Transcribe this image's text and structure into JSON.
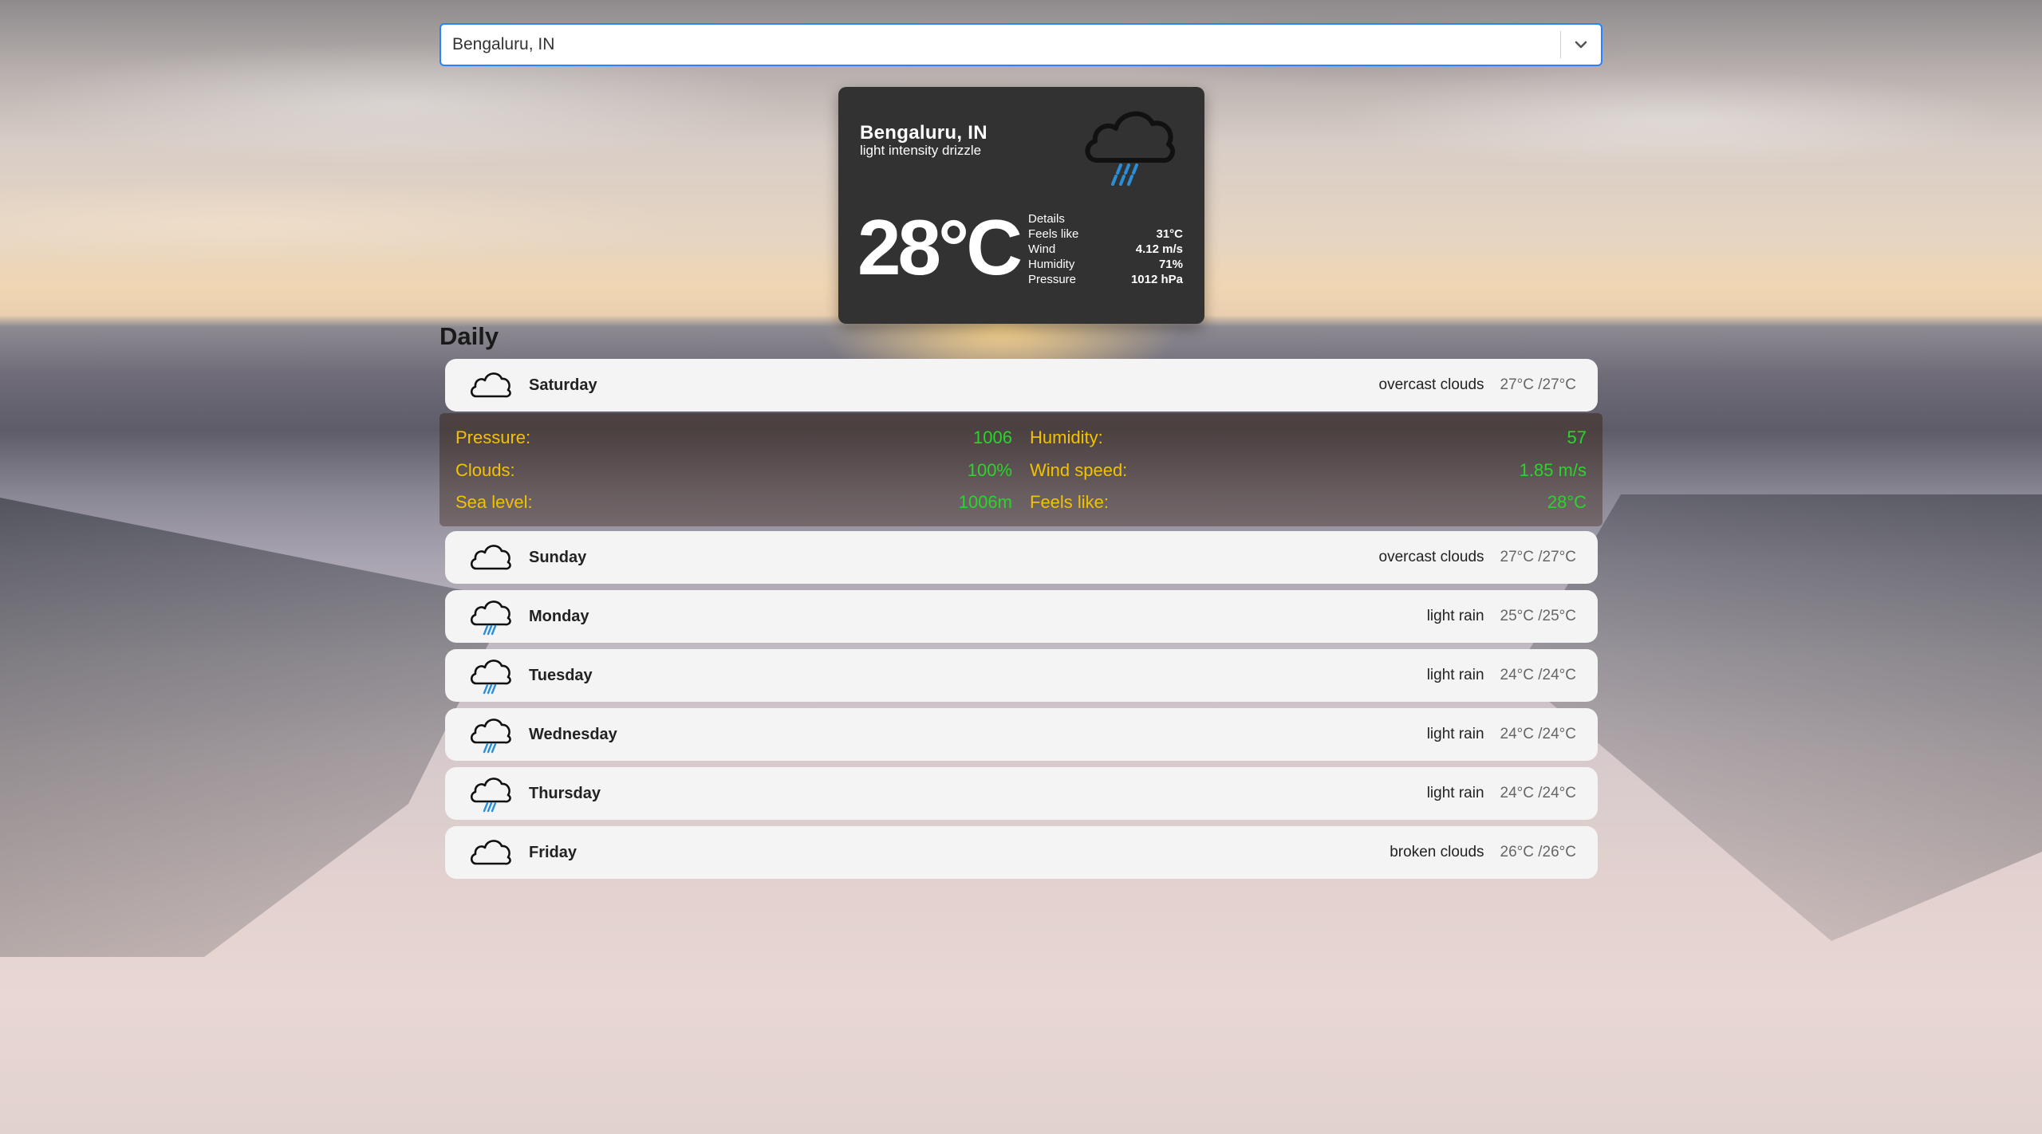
{
  "search": {
    "value": "Bengaluru, IN"
  },
  "current": {
    "city": "Bengaluru, IN",
    "description": "light intensity drizzle",
    "icon": "drizzle-cloud-icon",
    "temperature": "28°C",
    "details_title": "Details",
    "details": [
      {
        "label": "Feels like",
        "value": "31°C"
      },
      {
        "label": "Wind",
        "value": "4.12 m/s"
      },
      {
        "label": "Humidity",
        "value": "71%"
      },
      {
        "label": "Pressure",
        "value": "1012 hPa"
      }
    ]
  },
  "daily": {
    "title": "Daily",
    "days": [
      {
        "name": "Saturday",
        "icon": "cloud-icon",
        "desc": "overcast clouds",
        "temp": "27°C /27°C"
      },
      {
        "name": "Sunday",
        "icon": "cloud-icon",
        "desc": "overcast clouds",
        "temp": "27°C /27°C"
      },
      {
        "name": "Monday",
        "icon": "rain-cloud-icon",
        "desc": "light rain",
        "temp": "25°C /25°C"
      },
      {
        "name": "Tuesday",
        "icon": "rain-cloud-icon",
        "desc": "light rain",
        "temp": "24°C /24°C"
      },
      {
        "name": "Wednesday",
        "icon": "rain-cloud-icon",
        "desc": "light rain",
        "temp": "24°C /24°C"
      },
      {
        "name": "Thursday",
        "icon": "rain-cloud-icon",
        "desc": "light rain",
        "temp": "24°C /24°C"
      },
      {
        "name": "Friday",
        "icon": "cloud-icon",
        "desc": "broken clouds",
        "temp": "26°C /26°C"
      }
    ],
    "expanded": {
      "left": [
        {
          "label": "Pressure:",
          "value": "1006"
        },
        {
          "label": "Clouds:",
          "value": "100%"
        },
        {
          "label": "Sea level:",
          "value": "1006m"
        }
      ],
      "right": [
        {
          "label": "Humidity:",
          "value": "57"
        },
        {
          "label": "Wind speed:",
          "value": "1.85 m/s"
        },
        {
          "label": "Feels like:",
          "value": "28°C"
        }
      ]
    }
  },
  "colors": {
    "search_border": "#2684ff",
    "card_bg": "#323232",
    "detail_label": "#f2c200",
    "detail_value": "#2ad52a",
    "rain": "#2a8fd8"
  }
}
